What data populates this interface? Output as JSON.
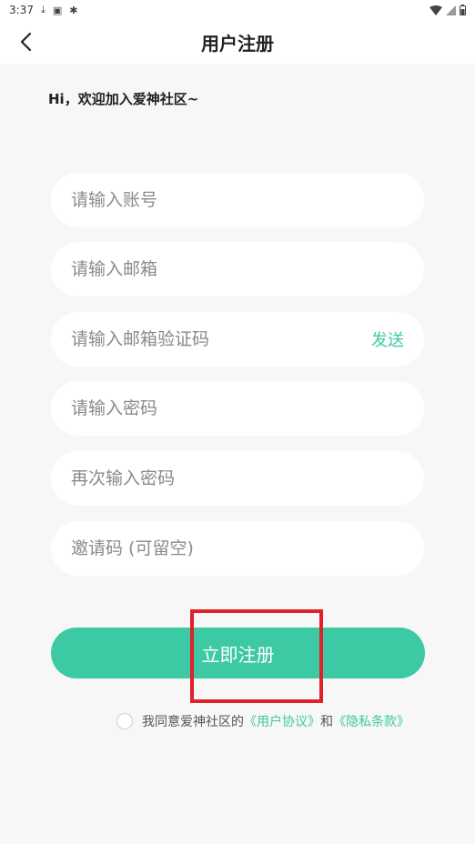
{
  "status_bar": {
    "time": "3:37"
  },
  "header": {
    "title": "用户注册"
  },
  "welcome": "Hi，欢迎加入爱神社区~",
  "form": {
    "account_placeholder": "请输入账号",
    "email_placeholder": "请输入邮箱",
    "code_placeholder": "请输入邮箱验证码",
    "send_label": "发送",
    "password_placeholder": "请输入密码",
    "confirm_placeholder": "再次输入密码",
    "invite_placeholder": "邀请码 (可留空)"
  },
  "register_label": "立即注册",
  "agreement": {
    "prefix": "我同意爱神社区的",
    "user_agreement": "《用户协议》",
    "and": "和",
    "privacy": "《隐私条款》"
  },
  "colors": {
    "accent": "#3cc9a4",
    "highlight": "#e0202a"
  }
}
